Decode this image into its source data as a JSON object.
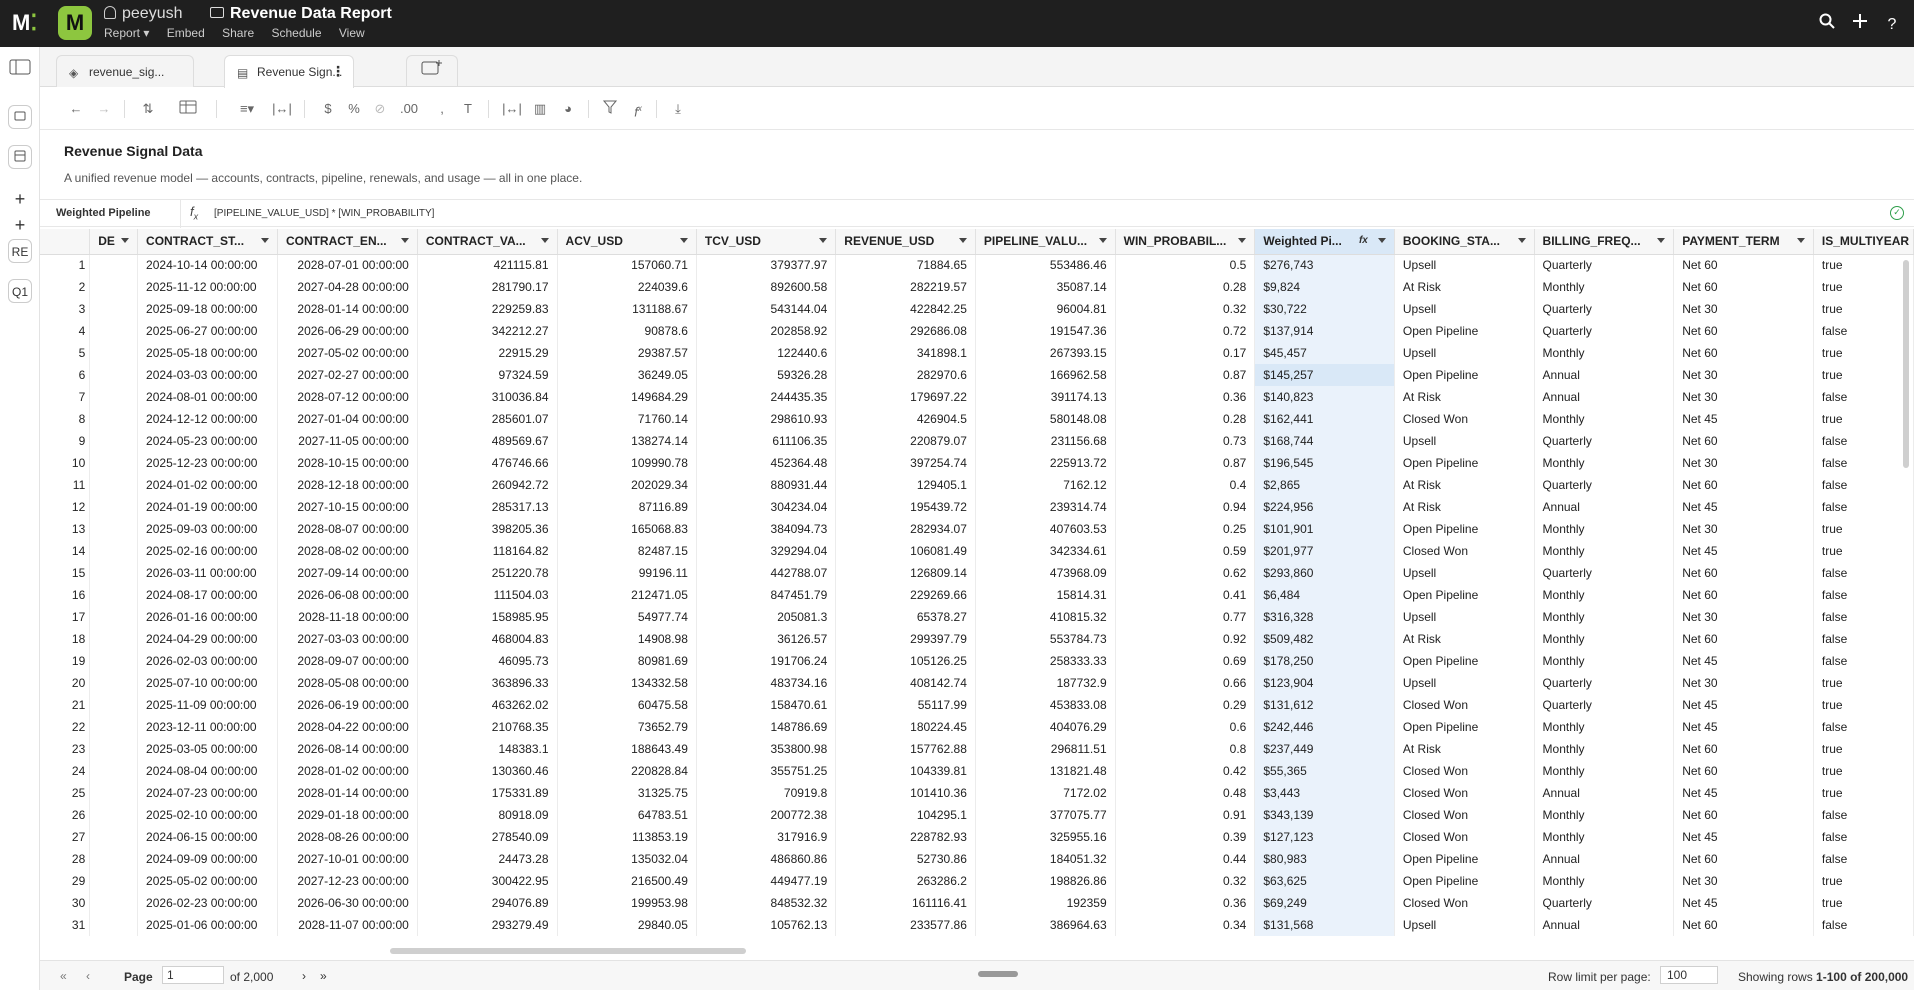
{
  "app": {
    "owner": "peeyush",
    "doc_title": "Revenue Data Report",
    "menus": [
      "Report ▾",
      "Embed",
      "Share",
      "Schedule",
      "View"
    ],
    "logo_letter": "M",
    "logo_text": "M"
  },
  "rail": {
    "items": [
      {
        "name": "add-page-button",
        "label": "+"
      },
      {
        "name": "add-item-button",
        "label": "+"
      },
      {
        "name": "rail-item-re",
        "label": "RE"
      },
      {
        "name": "rail-item-q1",
        "label": "Q1"
      }
    ]
  },
  "tabs": [
    {
      "label": "revenue_sig...",
      "active": false
    },
    {
      "label": "Revenue Sign...",
      "active": true
    }
  ],
  "page": {
    "title": "Revenue Signal Data",
    "description": "A unified revenue model — accounts, contracts, pipeline, renewals, and usage — all in one place."
  },
  "formula": {
    "column_name": "Weighted Pipeline",
    "fx": "fx",
    "expression": "[PIPELINE_VALUE_USD] * [WIN_PROBABILITY]"
  },
  "table": {
    "columns": [
      "DE",
      "CONTRACT_ST...",
      "CONTRACT_EN...",
      "CONTRACT_VA...",
      "ACV_USD",
      "TCV_USD",
      "REVENUE_USD",
      "PIPELINE_VALU...",
      "WIN_PROBABIL...",
      "Weighted Pi...",
      "BOOKING_STA...",
      "BILLING_FREQ...",
      "PAYMENT_TERM",
      "IS_MULTIYEAR"
    ],
    "rows": [
      [
        "1",
        "",
        "2024-10-14 00:00:00",
        "2028-07-01 00:00:00",
        "421115.81",
        "157060.71",
        "379377.97",
        "71884.65",
        "553486.46",
        "0.5",
        "$276,743",
        "Upsell",
        "Quarterly",
        "Net 60",
        "true"
      ],
      [
        "2",
        "",
        "2025-11-12 00:00:00",
        "2027-04-28 00:00:00",
        "281790.17",
        "224039.6",
        "892600.58",
        "282219.57",
        "35087.14",
        "0.28",
        "$9,824",
        "At Risk",
        "Monthly",
        "Net 60",
        "true"
      ],
      [
        "3",
        "",
        "2025-09-18 00:00:00",
        "2028-01-14 00:00:00",
        "229259.83",
        "131188.67",
        "543144.04",
        "422842.25",
        "96004.81",
        "0.32",
        "$30,722",
        "Upsell",
        "Quarterly",
        "Net 30",
        "true"
      ],
      [
        "4",
        "",
        "2025-06-27 00:00:00",
        "2026-06-29 00:00:00",
        "342212.27",
        "90878.6",
        "202858.92",
        "292686.08",
        "191547.36",
        "0.72",
        "$137,914",
        "Open Pipeline",
        "Quarterly",
        "Net 60",
        "false"
      ],
      [
        "5",
        "",
        "2025-05-18 00:00:00",
        "2027-05-02 00:00:00",
        "22915.29",
        "29387.57",
        "122440.6",
        "341898.1",
        "267393.15",
        "0.17",
        "$45,457",
        "Upsell",
        "Monthly",
        "Net 60",
        "true"
      ],
      [
        "6",
        "",
        "2024-03-03 00:00:00",
        "2027-02-27 00:00:00",
        "97324.59",
        "36249.05",
        "59326.28",
        "282970.6",
        "166962.58",
        "0.87",
        "$145,257",
        "Open Pipeline",
        "Annual",
        "Net 30",
        "true"
      ],
      [
        "7",
        "",
        "2024-08-01 00:00:00",
        "2028-07-12 00:00:00",
        "310036.84",
        "149684.29",
        "244435.35",
        "179697.22",
        "391174.13",
        "0.36",
        "$140,823",
        "At Risk",
        "Annual",
        "Net 30",
        "false"
      ],
      [
        "8",
        "",
        "2024-12-12 00:00:00",
        "2027-01-04 00:00:00",
        "285601.07",
        "71760.14",
        "298610.93",
        "426904.5",
        "580148.08",
        "0.28",
        "$162,441",
        "Closed Won",
        "Monthly",
        "Net 45",
        "true"
      ],
      [
        "9",
        "",
        "2024-05-23 00:00:00",
        "2027-11-05 00:00:00",
        "489569.67",
        "138274.14",
        "611106.35",
        "220879.07",
        "231156.68",
        "0.73",
        "$168,744",
        "Upsell",
        "Quarterly",
        "Net 60",
        "false"
      ],
      [
        "10",
        "",
        "2025-12-23 00:00:00",
        "2028-10-15 00:00:00",
        "476746.66",
        "109990.78",
        "452364.48",
        "397254.74",
        "225913.72",
        "0.87",
        "$196,545",
        "Open Pipeline",
        "Monthly",
        "Net 30",
        "false"
      ],
      [
        "11",
        "",
        "2024-01-02 00:00:00",
        "2028-12-18 00:00:00",
        "260942.72",
        "202029.34",
        "880931.44",
        "129405.1",
        "7162.12",
        "0.4",
        "$2,865",
        "At Risk",
        "Quarterly",
        "Net 60",
        "false"
      ],
      [
        "12",
        "",
        "2024-01-19 00:00:00",
        "2027-10-15 00:00:00",
        "285317.13",
        "87116.89",
        "304234.04",
        "195439.72",
        "239314.74",
        "0.94",
        "$224,956",
        "At Risk",
        "Annual",
        "Net 45",
        "false"
      ],
      [
        "13",
        "",
        "2025-09-03 00:00:00",
        "2028-08-07 00:00:00",
        "398205.36",
        "165068.83",
        "384094.73",
        "282934.07",
        "407603.53",
        "0.25",
        "$101,901",
        "Open Pipeline",
        "Monthly",
        "Net 30",
        "true"
      ],
      [
        "14",
        "",
        "2025-02-16 00:00:00",
        "2028-08-02 00:00:00",
        "118164.82",
        "82487.15",
        "329294.04",
        "106081.49",
        "342334.61",
        "0.59",
        "$201,977",
        "Closed Won",
        "Monthly",
        "Net 45",
        "true"
      ],
      [
        "15",
        "",
        "2026-03-11 00:00:00",
        "2027-09-14 00:00:00",
        "251220.78",
        "99196.11",
        "442788.07",
        "126809.14",
        "473968.09",
        "0.62",
        "$293,860",
        "Upsell",
        "Quarterly",
        "Net 60",
        "false"
      ],
      [
        "16",
        "",
        "2024-08-17 00:00:00",
        "2026-06-08 00:00:00",
        "111504.03",
        "212471.05",
        "847451.79",
        "229269.66",
        "15814.31",
        "0.41",
        "$6,484",
        "Open Pipeline",
        "Monthly",
        "Net 60",
        "false"
      ],
      [
        "17",
        "",
        "2026-01-16 00:00:00",
        "2028-11-18 00:00:00",
        "158985.95",
        "54977.74",
        "205081.3",
        "65378.27",
        "410815.32",
        "0.77",
        "$316,328",
        "Upsell",
        "Monthly",
        "Net 30",
        "false"
      ],
      [
        "18",
        "",
        "2024-04-29 00:00:00",
        "2027-03-03 00:00:00",
        "468004.83",
        "14908.98",
        "36126.57",
        "299397.79",
        "553784.73",
        "0.92",
        "$509,482",
        "At Risk",
        "Monthly",
        "Net 60",
        "false"
      ],
      [
        "19",
        "",
        "2026-02-03 00:00:00",
        "2028-09-07 00:00:00",
        "46095.73",
        "80981.69",
        "191706.24",
        "105126.25",
        "258333.33",
        "0.69",
        "$178,250",
        "Open Pipeline",
        "Monthly",
        "Net 45",
        "false"
      ],
      [
        "20",
        "",
        "2025-07-10 00:00:00",
        "2028-05-08 00:00:00",
        "363896.33",
        "134332.58",
        "483734.16",
        "408142.74",
        "187732.9",
        "0.66",
        "$123,904",
        "Upsell",
        "Quarterly",
        "Net 30",
        "true"
      ],
      [
        "21",
        "",
        "2025-11-09 00:00:00",
        "2026-06-19 00:00:00",
        "463262.02",
        "60475.58",
        "158470.61",
        "55117.99",
        "453833.08",
        "0.29",
        "$131,612",
        "Closed Won",
        "Quarterly",
        "Net 45",
        "true"
      ],
      [
        "22",
        "",
        "2023-12-11 00:00:00",
        "2028-04-22 00:00:00",
        "210768.35",
        "73652.79",
        "148786.69",
        "180224.45",
        "404076.29",
        "0.6",
        "$242,446",
        "Open Pipeline",
        "Monthly",
        "Net 45",
        "false"
      ],
      [
        "23",
        "",
        "2025-03-05 00:00:00",
        "2026-08-14 00:00:00",
        "148383.1",
        "188643.49",
        "353800.98",
        "157762.88",
        "296811.51",
        "0.8",
        "$237,449",
        "At Risk",
        "Monthly",
        "Net 60",
        "true"
      ],
      [
        "24",
        "",
        "2024-08-04 00:00:00",
        "2028-01-02 00:00:00",
        "130360.46",
        "220828.84",
        "355751.25",
        "104339.81",
        "131821.48",
        "0.42",
        "$55,365",
        "Closed Won",
        "Monthly",
        "Net 60",
        "true"
      ],
      [
        "25",
        "",
        "2024-07-23 00:00:00",
        "2028-01-14 00:00:00",
        "175331.89",
        "31325.75",
        "70919.8",
        "101410.36",
        "7172.02",
        "0.48",
        "$3,443",
        "Closed Won",
        "Annual",
        "Net 45",
        "true"
      ],
      [
        "26",
        "",
        "2025-02-10 00:00:00",
        "2029-01-18 00:00:00",
        "80918.09",
        "64783.51",
        "200772.38",
        "104295.1",
        "377075.77",
        "0.91",
        "$343,139",
        "Closed Won",
        "Monthly",
        "Net 60",
        "false"
      ],
      [
        "27",
        "",
        "2024-06-15 00:00:00",
        "2028-08-26 00:00:00",
        "278540.09",
        "113853.19",
        "317916.9",
        "228782.93",
        "325955.16",
        "0.39",
        "$127,123",
        "Closed Won",
        "Monthly",
        "Net 45",
        "false"
      ],
      [
        "28",
        "",
        "2024-09-09 00:00:00",
        "2027-10-01 00:00:00",
        "24473.28",
        "135032.04",
        "486860.86",
        "52730.86",
        "184051.32",
        "0.44",
        "$80,983",
        "Open Pipeline",
        "Annual",
        "Net 60",
        "false"
      ],
      [
        "29",
        "",
        "2025-05-02 00:00:00",
        "2027-12-23 00:00:00",
        "300422.95",
        "216500.49",
        "449477.19",
        "263286.2",
        "198826.86",
        "0.32",
        "$63,625",
        "Open Pipeline",
        "Monthly",
        "Net 30",
        "true"
      ],
      [
        "30",
        "",
        "2026-02-23 00:00:00",
        "2026-06-30 00:00:00",
        "294076.89",
        "199953.98",
        "848532.32",
        "161116.41",
        "192359",
        "0.36",
        "$69,249",
        "Closed Won",
        "Quarterly",
        "Net 45",
        "true"
      ],
      [
        "31",
        "",
        "2025-01-06 00:00:00",
        "2028-11-07 00:00:00",
        "293279.49",
        "29840.05",
        "105762.13",
        "233577.86",
        "386964.63",
        "0.34",
        "$131,568",
        "Upsell",
        "Annual",
        "Net 60",
        "false"
      ]
    ]
  },
  "footer": {
    "page_label": "Page",
    "page_value": "1",
    "page_of": "of 2,000",
    "row_limit_label": "Row limit per page:",
    "row_limit_value": "100",
    "showing_label": "Showing rows",
    "showing_value": "1-100 of 200,000"
  },
  "colors": {
    "accent": "#8dc63f",
    "selection": "#d9e8f7",
    "topbar": "#1f1f1f"
  },
  "icons": {
    "toolbar": [
      "undo-icon",
      "redo-icon",
      "sort-icon",
      "table-icon",
      "align-icon",
      "column-width-icon",
      "currency-icon",
      "percent-icon",
      "link-icon",
      "decimal-icon",
      "comma-icon",
      "text-format-icon",
      "fit-width-icon",
      "columns-icon",
      "palette-icon",
      "filter-icon",
      "formula-icon",
      "download-icon"
    ]
  }
}
